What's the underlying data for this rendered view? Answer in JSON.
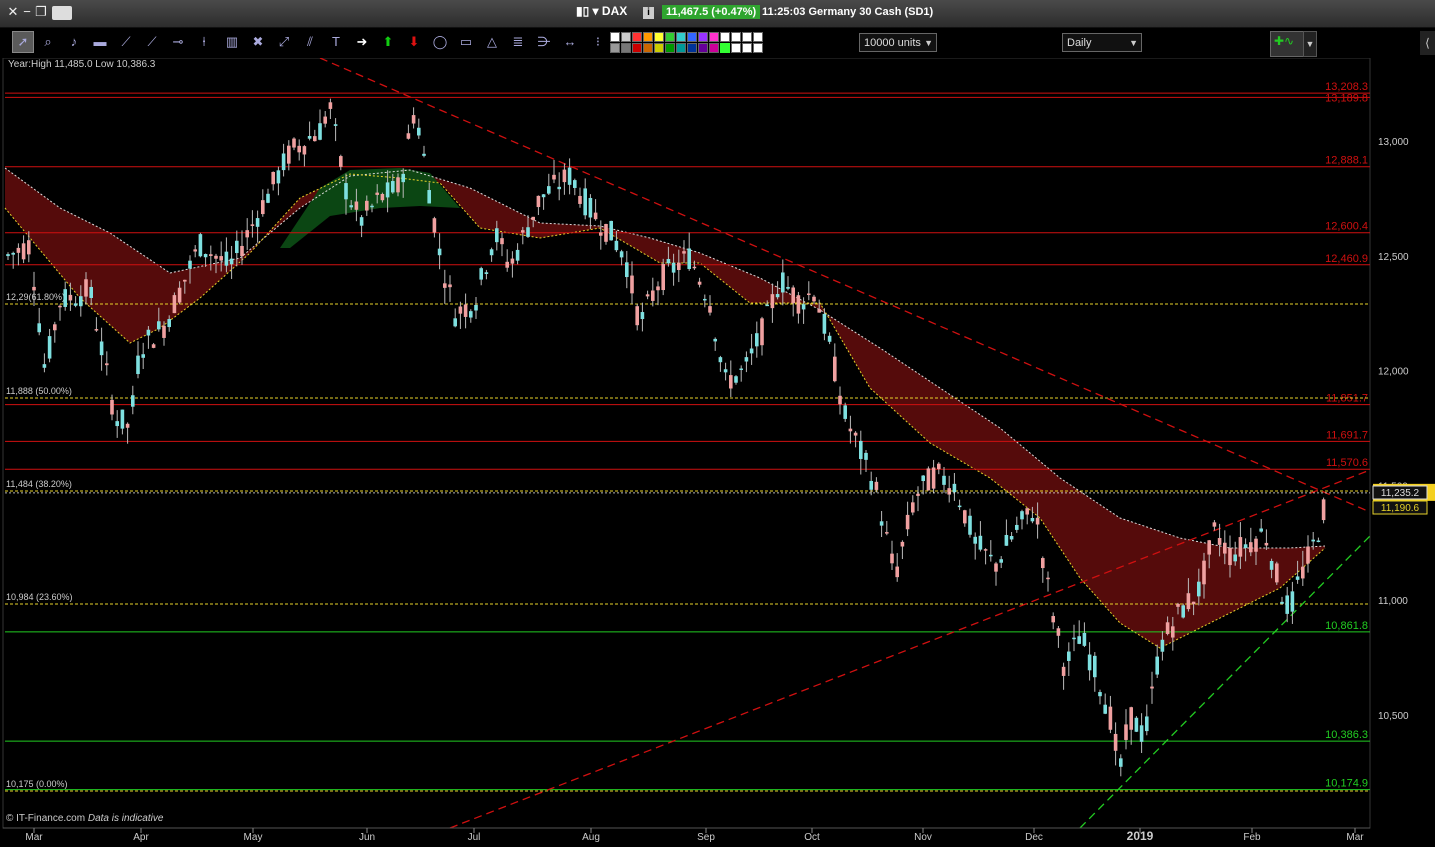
{
  "titlebar": {
    "symbol": "DAX",
    "price_badge": "11,467.5 (+0.47%)",
    "time": "11:25:03",
    "instrument": "Germany 30 Cash (SD1)"
  },
  "toolbar": {
    "units_select": "10000 units",
    "period_select": "Daily"
  },
  "chart": {
    "year_range": "Year:High 11,485.0 Low 10,386.3",
    "footer_brand": "© IT-Finance.com",
    "footer_note": "Data is indicative",
    "price_axis": [
      "13,000",
      "12,500",
      "12,000",
      "11,500",
      "11,000",
      "10,500"
    ],
    "months": [
      "Mar",
      "Apr",
      "May",
      "Jun",
      "Jul",
      "Aug",
      "Sep",
      "Oct",
      "Nov",
      "Dec",
      "2019",
      "Feb",
      "Mar"
    ],
    "red_levels": [
      "13,208.3",
      "13,189.8",
      "12,888.1",
      "12,600.4",
      "12,460.9",
      "11,851.7",
      "11,691.7",
      "11,570.6"
    ],
    "green_levels": [
      "10,861.8",
      "10,386.3",
      "10,174.9"
    ],
    "fib_levels": [
      "12,29(61.80%)",
      "11,888 (50.00%)",
      "11,484 (38.20%)",
      "10,984 (23.60%)",
      "10,175 (0.00%)"
    ],
    "current_price": "11,467.5",
    "ma_fast": "11,235.2",
    "ma_slow": "11,190.6"
  },
  "colors": {
    "background": "#000000",
    "red_line": "#d01010",
    "green_line": "#22cc22",
    "fib_line": "#e6d22a",
    "up_candle": "#7ee0e0",
    "down_candle": "#f0a0a0",
    "cloud_red": "#5a0c0c",
    "cloud_green": "#0c4a14",
    "price_badge": "#2fa52f",
    "current_price_bg": "#f4d020"
  },
  "icons": [
    "pointer-icon",
    "zoom-icon",
    "alarm-icon",
    "ruler-icon",
    "trendline-icon",
    "ray-icon",
    "horizontal-line-icon",
    "vertical-line-icon",
    "trash-icon",
    "tools-icon",
    "channel-icon",
    "pitchfork-icon",
    "text-icon",
    "arrow-right-icon",
    "arrow-up-icon",
    "arrow-down-icon",
    "ellipse-icon",
    "rectangle-icon",
    "triangle-icon",
    "fibonacci-icon",
    "fib-fan-icon",
    "measure-icon",
    "color-palette-icon",
    "indicators-icon"
  ]
}
